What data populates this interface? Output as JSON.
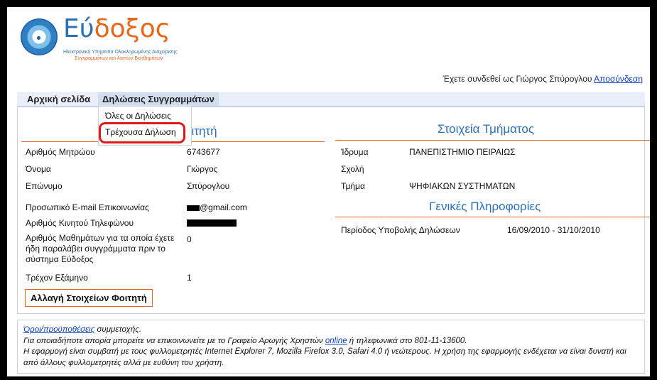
{
  "logo": {
    "title_part1": "Εύ",
    "title_part2": "δοξος",
    "subtitle_line1": "Ηλεκτρονική Υπηρεσία Ολοκληρωμένης Διαχείρισης",
    "subtitle_line2": "Συγγραμμάτων και λοιπών Βοηθημάτων"
  },
  "header": {
    "login_text": "Έχετε συνδεθεί ως Γιώργος Σπύρογλου",
    "logout_link": "Αποσύνδεση"
  },
  "menu": {
    "home": "Αρχική σελίδα",
    "declarations": "Δηλώσεις Συγγραμμάτων",
    "dropdown": {
      "all": "Όλες οι Δηλώσεις",
      "current": "Τρέχουσα Δήλωση"
    }
  },
  "student": {
    "title": "οιτητή",
    "fields": [
      {
        "label": "Αριθμός Μητρώου",
        "value": "6743677"
      },
      {
        "label": "Όνομα",
        "value": "Γιώργος"
      },
      {
        "label": "Επώνυμο",
        "value": "Σπύρογλου"
      },
      {
        "label": "Προσωπικό E-mail Επικοινωνίας",
        "value": "@gmail.com"
      },
      {
        "label": "Αριθμός Κινητού Τηλεφώνου",
        "value": ""
      },
      {
        "label": "Αριθμός Μαθημάτων για τα οποία έχετε ήδη παραλάβει συγγράμματα πριν το σύστημα Εύδοξος",
        "value": "0"
      },
      {
        "label": "Τρέχον Εξάμηνο",
        "value": "1"
      }
    ],
    "edit_button": "Αλλαγή Στοιχείων Φοιτητή"
  },
  "department": {
    "title": "Στοιχεία Τμήματος",
    "fields": [
      {
        "label": "Ίδρυμα",
        "value": "ΠΑΝΕΠΙΣΤΗΜΙΟ ΠΕΙΡΑΙΩΣ"
      },
      {
        "label": "Σχολή",
        "value": ""
      },
      {
        "label": "Τμήμα",
        "value": "ΨΗΦΙΑΚΩΝ ΣΥΣΤΗΜΑΤΩΝ"
      }
    ]
  },
  "general": {
    "title": "Γενικές Πληροφορίες",
    "period_label": "Περίοδος Υποβολής Δηλώσεων",
    "period_value": "16/09/2010 - 31/10/2010"
  },
  "footer": {
    "terms_link": "Όροι/προϋποθέσεις",
    "terms_rest": " συμμετοχής.",
    "help_pre": "Για οποιαδήποτε απορία μπορείτε να επικοινωνείτε με το Γραφείο Αρωγής Χρηστών ",
    "help_link": "online",
    "help_post": " ή τηλεφωνικά στο 801-11-13600.",
    "compat": "Η εφαρμογή είναι συμβατή με τους φυλλομετρητές Internet Explorer 7, Mozilla Firefox 3.0, Safari 4.0 ή νεώτερους. Η χρήση της εφαρμογής ενδέχεται να είναι δυνατή και από άλλους φυλλομετρητές αλλά με ευθύνη του χρήστη."
  },
  "colors": {
    "brand_blue": "#2c6fb3",
    "brand_orange": "#e8661a",
    "highlight_red": "#e01818"
  }
}
